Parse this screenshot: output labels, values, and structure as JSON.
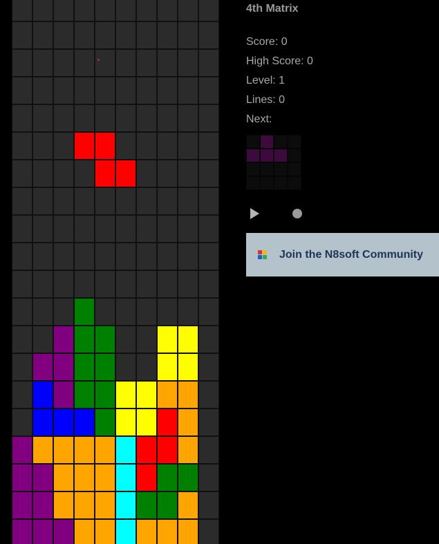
{
  "app": {
    "title": "4th Matrix"
  },
  "stats": {
    "score": "Score: 0",
    "high_score": "High Score: 0",
    "level": "Level: 1",
    "lines": "Lines: 0",
    "next_label": "Next:"
  },
  "colors": {
    "empty": "#2b2b2b",
    "grid_line": "#111111",
    "R": "#ff0000",
    "G": "#008000",
    "P": "#800080",
    "Y": "#ffff00",
    "B": "#0000ff",
    "O": "#ffa500",
    "C": "#00ffff",
    "next_piece": "#3d0a3d",
    "next_empty": "#0c0c0c"
  },
  "board": {
    "columns": 10,
    "rows": [
      "..........",
      "..........",
      "..........",
      "..........",
      "..........",
      "...RR.....",
      "....RR....",
      "..........",
      "..........",
      "..........",
      "..........",
      "...G......",
      "..PGG..YY.",
      ".PPGG..YY.",
      ".BPGGYYOO.",
      ".BBBGYYRO.",
      "POOOOCRRO.",
      "PPOOOCRGG.",
      "PPOOOCGGO.",
      "PPPOOCOOO."
    ]
  },
  "next_piece": {
    "rows": [
      ".X..",
      "XXX.",
      "....",
      "...."
    ]
  },
  "controls": {
    "play_icon": "play-icon",
    "record_icon": "record-icon"
  },
  "community": {
    "label": "Join the N8soft Community",
    "logo_icon": "n8soft-logo-icon",
    "background": "#b4c2cc",
    "text_color": "#1c3552"
  }
}
